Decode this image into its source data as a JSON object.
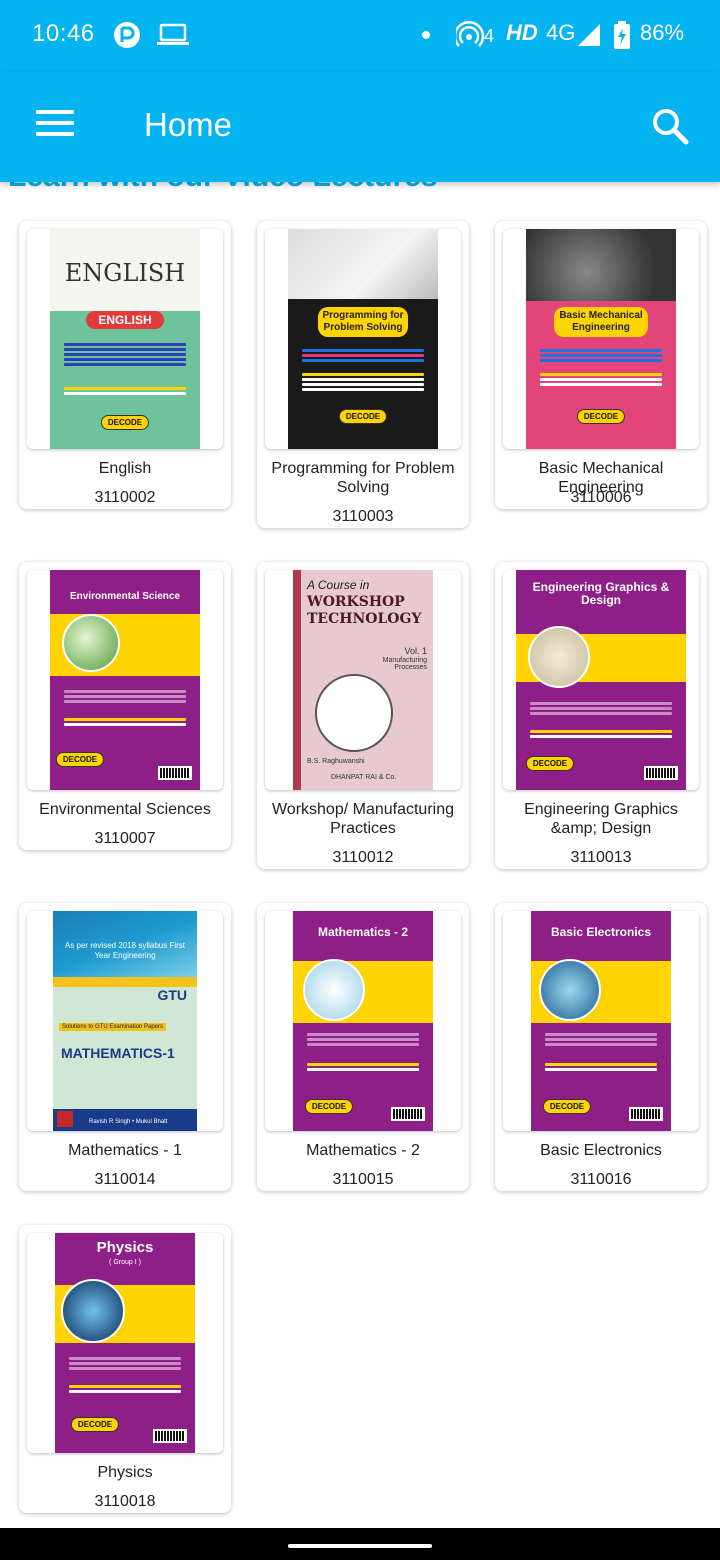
{
  "status_bar": {
    "time": "10:46",
    "hotspot_count": "4",
    "hd": "HD",
    "network": "4G",
    "battery": "86%"
  },
  "app_bar": {
    "title": "Home",
    "menu_icon": "hamburger-menu-icon",
    "search_icon": "search-icon"
  },
  "section_peek": "Learn with our Video Lectures",
  "courses": [
    {
      "name": "English",
      "code": "3110002",
      "cover_color": "#6fc39a"
    },
    {
      "name": "Programming for Problem Solving",
      "code": "3110003",
      "cover_color": "#1a1a1a"
    },
    {
      "name": "Basic Mechanical Engineering",
      "code": "3110006",
      "cover_color": "#e2457a"
    },
    {
      "name": "Environmental Sciences",
      "code": "3110007",
      "cover_color": "#8e1f86"
    },
    {
      "name": "Workshop/ Manufacturing Practices",
      "code": "3110012",
      "cover_color": "#e8c9cf"
    },
    {
      "name": "Engineering Graphics &amp; Design",
      "code": "3110013",
      "cover_color": "#8e1f86"
    },
    {
      "name": "Mathematics - 1",
      "code": "3110014",
      "cover_color": "#cfe7d3"
    },
    {
      "name": "Mathematics - 2",
      "code": "3110015",
      "cover_color": "#8e1f86"
    },
    {
      "name": "Basic Electronics",
      "code": "3110016",
      "cover_color": "#8e1f86"
    },
    {
      "name": "Physics",
      "code": "3110018",
      "cover_color": "#8e1f86"
    }
  ],
  "covers": {
    "english_word": "ENGLISH",
    "english_banner": "ENGLISH",
    "pps_title": "Programming for Problem Solving",
    "bme_title": "Basic Mechanical Engineering",
    "env_title": "Environmental Science",
    "workshop_top": "A Course in",
    "workshop_title": "WORKSHOP TECHNOLOGY",
    "workshop_vol": "Vol. 1",
    "workshop_sub": "Manufacturing Processes",
    "workshop_author": "B.S. Raghuwanshi",
    "workshop_publisher": "DHANPAT RAI & Co.",
    "egd_title": "Engineering Graphics & Design",
    "m1_top": "As per revised 2018 syllabus First Year Engineering",
    "m1_gtu": "GTU",
    "m1_solutions": "Solutions to GTU Examination Papers",
    "m1_title": "MATHEMATICS-1",
    "m1_authors": "Ravish R Singh • Mukul Bhatt",
    "m2_title": "Mathematics - 2",
    "be_title": "Basic Electronics",
    "phy_title": "Physics",
    "phy_group": "( Group I )",
    "decode": "DECODE"
  }
}
